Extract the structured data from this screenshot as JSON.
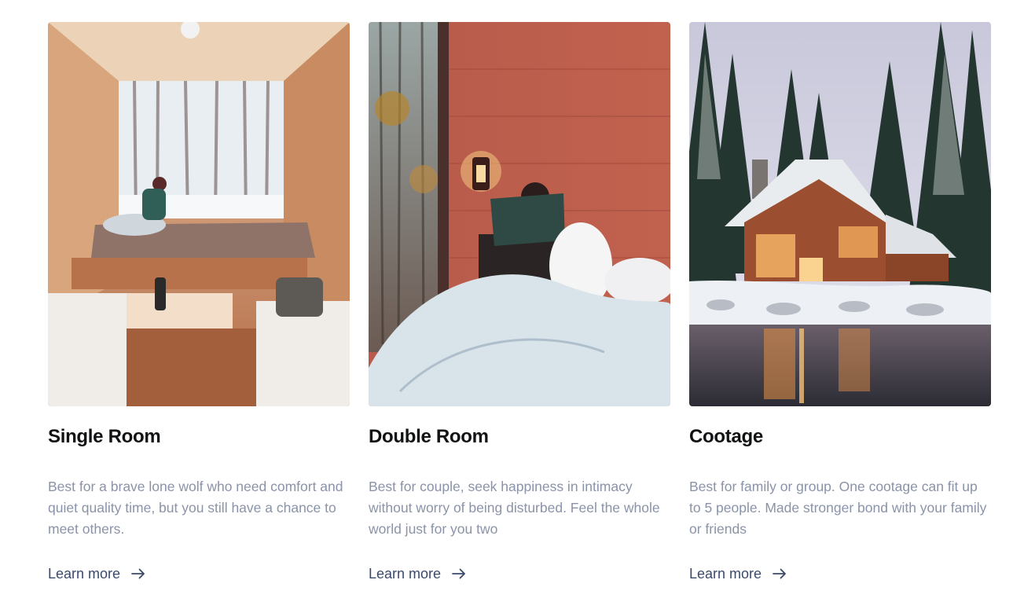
{
  "cards": [
    {
      "title": "Single Room",
      "description": "Best for a brave lone wolf who need comfort and quiet quality time, but you still have a chance to meet others.",
      "link_label": "Learn more",
      "image": "cabin-interior-photo",
      "arrow_icon": "arrow-right-icon"
    },
    {
      "title": "Double Room",
      "description": "Best for couple, seek happiness in intimacy without worry of being disturbed. Feel the whole world just for you two",
      "link_label": "Learn more",
      "image": "reading-in-bed-photo",
      "arrow_icon": "arrow-right-icon"
    },
    {
      "title": "Cootage",
      "description": "Best for family or group. One cootage can fit up to 5 people. Made stronger bond with your family or friends",
      "link_label": "Learn more",
      "image": "snowy-cottage-photo",
      "arrow_icon": "arrow-right-icon"
    }
  ],
  "colors": {
    "title": "#111214",
    "description": "#8a93a8",
    "link": "#3b4a6b"
  }
}
